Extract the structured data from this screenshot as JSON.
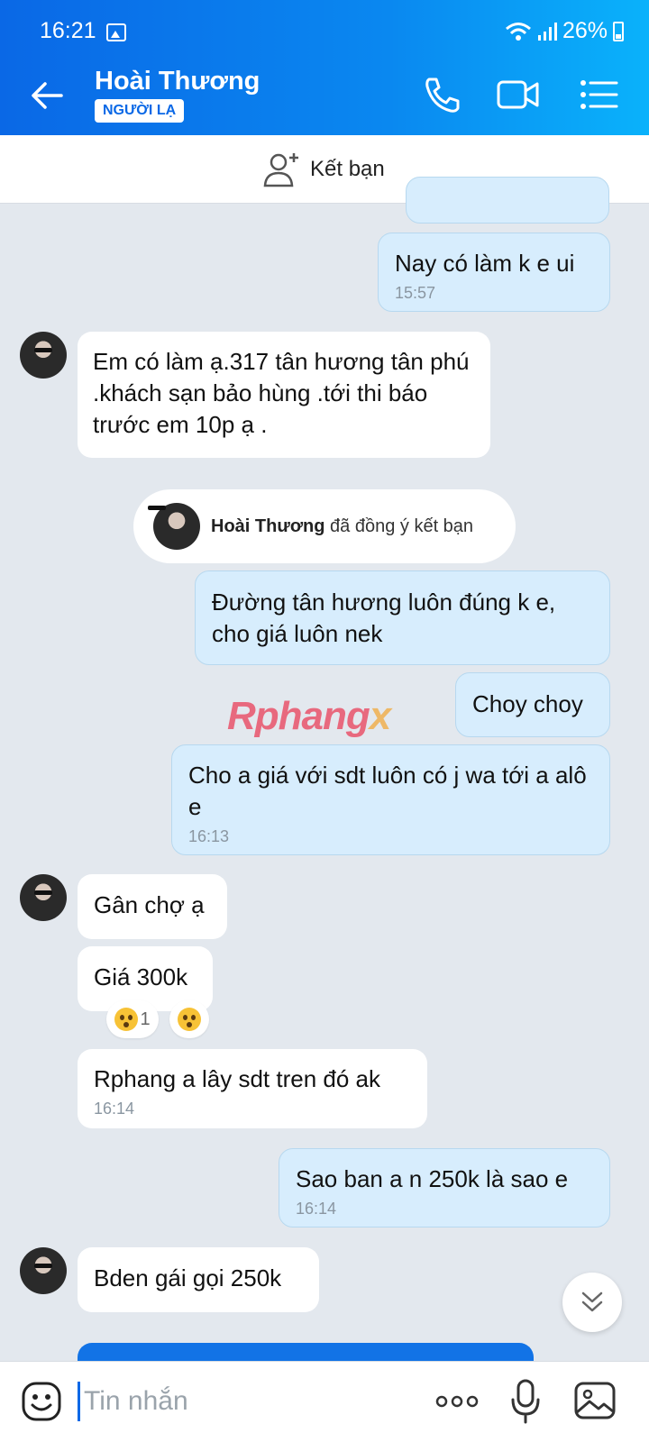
{
  "status_bar": {
    "time": "16:21",
    "battery": "26%"
  },
  "header": {
    "contact_name": "Hoài Thương",
    "stranger_badge": "NGƯỜI LẠ"
  },
  "add_friend": {
    "label": "Kết bạn"
  },
  "messages": [
    {
      "sender": "me",
      "text": "Nay có làm k e ui",
      "time": "15:57"
    },
    {
      "sender": "them",
      "text": " Em có làm ạ.317 tân hương tân phú .khách sạn bảo hùng .tới thi báo trước em 10p ạ ."
    },
    {
      "sender": "me",
      "text": "Đường tân hương luôn đúng k e, cho giá luôn nek"
    },
    {
      "sender": "me",
      "text": "Choy choy"
    },
    {
      "sender": "me",
      "text": "Cho a giá với sdt luôn có j wa tới a alô e",
      "time": "16:13"
    },
    {
      "sender": "them",
      "text": "Gân chợ ạ"
    },
    {
      "sender": "them",
      "text": "Giá 300k"
    },
    {
      "sender": "them",
      "text": "Rphang a lây sdt tren đó ak",
      "time": "16:14"
    },
    {
      "sender": "me",
      "text": "Sao ban a n 250k là sao e",
      "time": "16:14"
    },
    {
      "sender": "them",
      "text": "Bden gái gọi 250k"
    }
  ],
  "system_notice": {
    "name": "Hoài Thương",
    "text": "đã đồng ý kết bạn"
  },
  "reaction": {
    "count": "1"
  },
  "watermark": {
    "part1": "Rphang",
    "part2": "x"
  },
  "input": {
    "placeholder": "Tin nhắn"
  },
  "colors": {
    "accent": "#0a68e6",
    "my_bubble": "#d7edfd",
    "their_bubble": "#ffffff",
    "chat_bg": "#e3e8ee"
  }
}
